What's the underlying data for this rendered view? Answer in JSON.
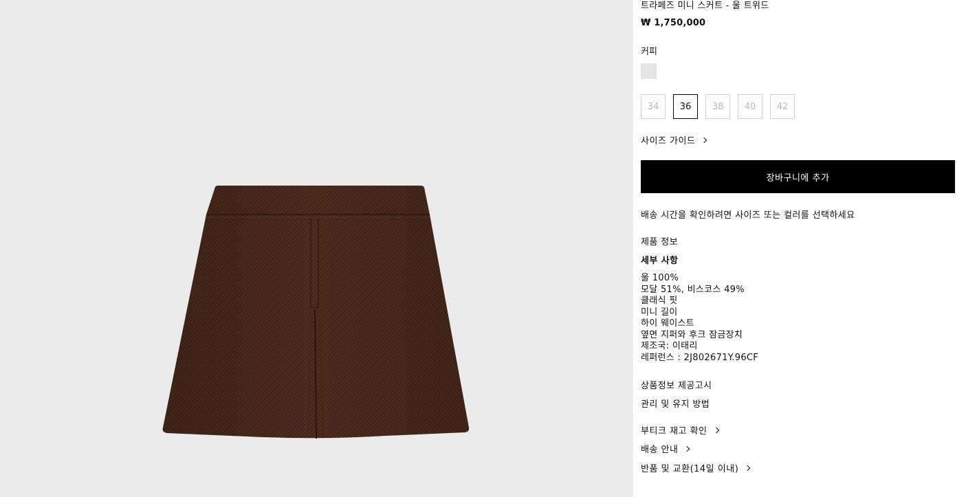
{
  "product": {
    "title": "트라페즈 미니 스커트 - 울 트위드",
    "price": "₩ 1,750,000",
    "color_label": "커피",
    "swatch_color": "#e4e4e4",
    "image_color": "#4a2a1c",
    "sizes": [
      {
        "label": "34",
        "selected": false
      },
      {
        "label": "36",
        "selected": true
      },
      {
        "label": "38",
        "selected": false
      },
      {
        "label": "40",
        "selected": false
      },
      {
        "label": "42",
        "selected": false
      }
    ],
    "size_guide": "사이즈 가이드",
    "add_to_cart": "장바구니에 추가",
    "delivery_note": "배송 시간을 확인하려면 사이즈 또는 컬러를 선택하세요",
    "product_info": "제품 정보",
    "details_heading": "세부 사항",
    "details": [
      "울 100%",
      "모달 51%, 비스코스 49%",
      "클래식 핏",
      "미니 길이",
      "하이 웨이스트",
      "옆면 지퍼와 후크 잠금장치",
      "제조국: 이태리",
      "레퍼런스 : 2J802671Y.96CF"
    ],
    "notice": "상품정보 제공고시",
    "care": "관리 및 유지 방법",
    "boutique_stock": "부티크 재고 확인",
    "shipping": "배송 안내",
    "returns": "반품 및 교환(14일 이내)"
  }
}
